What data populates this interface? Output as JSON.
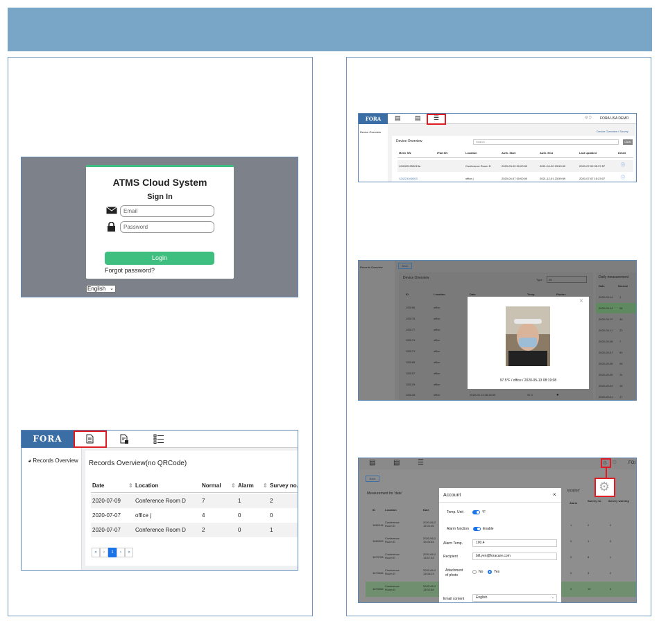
{
  "login": {
    "title": "ATMS Cloud System",
    "subtitle": "Sign In",
    "email_placeholder": "Email",
    "password_placeholder": "Password",
    "login_button": "Login",
    "forgot": "Forgot password?",
    "language": "English"
  },
  "records": {
    "logo": "FORA",
    "sidebar_item": "Records Overview",
    "heading": "Records Overview(no QRCode)",
    "columns": [
      "Date",
      "Location",
      "Normal",
      "Alarm",
      "Survey no."
    ],
    "rows": [
      [
        "2020-07-09",
        "Conference Room D",
        "7",
        "1",
        "2"
      ],
      [
        "2020-07-07",
        "office j",
        "4",
        "0",
        "0"
      ],
      [
        "2020-07-07",
        "Conference Room D",
        "2",
        "0",
        "1"
      ]
    ],
    "pagination": [
      "«",
      "‹",
      "1",
      "›",
      "»"
    ]
  },
  "device": {
    "logo": "FORA",
    "account": "FORA USA DEMO",
    "sidebar_item": "Device Overview",
    "breadcrumb": "Device Overview / Survey",
    "heading": "Device Overview",
    "search_placeholder": "Search",
    "clear": "Clear",
    "columns": [
      "Meter SN",
      "iPad SN",
      "Location",
      "Auth. Start",
      "Auth. End",
      "Last updated",
      "Detail"
    ],
    "rows": [
      [
        "1242201090013a",
        "",
        "Conference Room D",
        "2020-03-20 00:00:00",
        "2021-04-20 23:59:59",
        "2020-07-09 05:37:57"
      ],
      [
        "124221040003",
        "",
        "office j",
        "2020-04-07 00:00:00",
        "2021-12-01 23:59:59",
        "2020-07-07 15:23:07"
      ]
    ]
  },
  "records2": {
    "sidebar_item": "Records Overview",
    "back": "Back",
    "heading": "Device Overview",
    "type_label": "Type",
    "type_value": "All",
    "columns": [
      "ID",
      "Location",
      "Date",
      "Temp.",
      "Photos"
    ],
    "ids": [
      "153186",
      "153178",
      "153177",
      "153174",
      "153171",
      "153165",
      "153157",
      "153129",
      "153128"
    ],
    "location": "office",
    "last_row_date": "2020-05-13 08:18:50",
    "last_row_temp": "97.3",
    "photo_caption": "97.5°F / office / 2020-05-13 08:19:08",
    "daily_heading": "Daily measurement",
    "daily_columns": [
      "Date",
      "Normal"
    ],
    "daily_rows": [
      [
        "2020-05-14",
        "1"
      ],
      [
        "2020-05-13",
        "28"
      ],
      [
        "2020-05-12",
        "30"
      ],
      [
        "2020-05-11",
        "23"
      ],
      [
        "2020-05-08",
        "7"
      ],
      [
        "2020-05-07",
        "53"
      ],
      [
        "2020-05-06",
        "26"
      ],
      [
        "2020-05-05",
        "14"
      ],
      [
        "2020-05-04",
        "16"
      ],
      [
        "2020-05-01",
        "17"
      ]
    ]
  },
  "account": {
    "back": "Back",
    "bg_heading": "Measurement for 'date'",
    "bg_location": "location'",
    "bg_columns": [
      "ID",
      "Location",
      "Date",
      "Alarm",
      "Survey no.",
      "Survey warning"
    ],
    "bg_rows": [
      [
        "1680244",
        "Conference Room D",
        "2020-06-2 15:02:05",
        "1",
        "2",
        "2"
      ],
      [
        "1680005",
        "Conference Room D",
        "2020-06-2 15:00:54",
        "0",
        "1",
        "0"
      ],
      [
        "1673708",
        "Conference Room D",
        "2020-06-2 13:57:33",
        "0",
        "8",
        "1"
      ],
      [
        "1673466",
        "Conference Room D",
        "2020-06-2 13:08:23",
        "0",
        "3",
        "2"
      ],
      [
        "1673266",
        "Conference Room D",
        "2020-06-2 13:02:58",
        "0",
        "10",
        "4"
      ]
    ],
    "modal_title": "Account",
    "temp_unit_label": "Temp. Unit",
    "temp_unit_value": "°F",
    "alarm_function_label": "Alarm function",
    "alarm_function_value": "Enable",
    "alarm_temp_label": "Alarm Temp.",
    "alarm_temp_value": "100.4",
    "recipient_label": "Recipient",
    "recipient_value": "bill.yen@foracare.com",
    "attachment_label": "Attachment of photo",
    "no_label": "No",
    "yes_label": "Yes",
    "email_content_label": "Email content",
    "email_content_value": "English",
    "corner_text": "FOI"
  },
  "colors": {
    "banner": "#79a5c6",
    "panel_border": "#6f97bd",
    "fora_blue": "#3b6ea5",
    "login_green": "#3fbf7f",
    "highlight_red": "#e01b24",
    "toggle_blue": "#1a73e8"
  }
}
